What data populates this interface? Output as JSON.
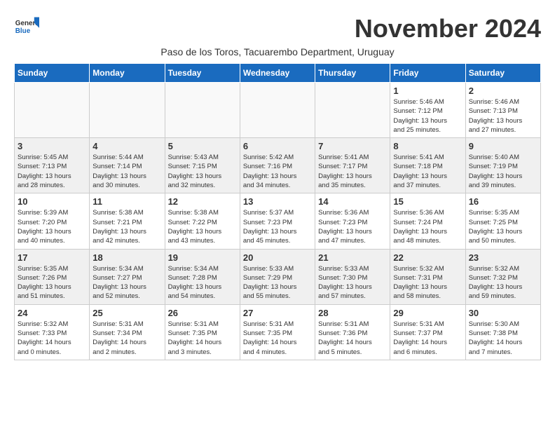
{
  "logo": {
    "line1": "General",
    "line2": "Blue"
  },
  "title": "November 2024",
  "subtitle": "Paso de los Toros, Tacuarembo Department, Uruguay",
  "days_header": [
    "Sunday",
    "Monday",
    "Tuesday",
    "Wednesday",
    "Thursday",
    "Friday",
    "Saturday"
  ],
  "weeks": [
    [
      {
        "day": "",
        "detail": ""
      },
      {
        "day": "",
        "detail": ""
      },
      {
        "day": "",
        "detail": ""
      },
      {
        "day": "",
        "detail": ""
      },
      {
        "day": "",
        "detail": ""
      },
      {
        "day": "1",
        "detail": "Sunrise: 5:46 AM\nSunset: 7:12 PM\nDaylight: 13 hours\nand 25 minutes."
      },
      {
        "day": "2",
        "detail": "Sunrise: 5:46 AM\nSunset: 7:13 PM\nDaylight: 13 hours\nand 27 minutes."
      }
    ],
    [
      {
        "day": "3",
        "detail": "Sunrise: 5:45 AM\nSunset: 7:13 PM\nDaylight: 13 hours\nand 28 minutes."
      },
      {
        "day": "4",
        "detail": "Sunrise: 5:44 AM\nSunset: 7:14 PM\nDaylight: 13 hours\nand 30 minutes."
      },
      {
        "day": "5",
        "detail": "Sunrise: 5:43 AM\nSunset: 7:15 PM\nDaylight: 13 hours\nand 32 minutes."
      },
      {
        "day": "6",
        "detail": "Sunrise: 5:42 AM\nSunset: 7:16 PM\nDaylight: 13 hours\nand 34 minutes."
      },
      {
        "day": "7",
        "detail": "Sunrise: 5:41 AM\nSunset: 7:17 PM\nDaylight: 13 hours\nand 35 minutes."
      },
      {
        "day": "8",
        "detail": "Sunrise: 5:41 AM\nSunset: 7:18 PM\nDaylight: 13 hours\nand 37 minutes."
      },
      {
        "day": "9",
        "detail": "Sunrise: 5:40 AM\nSunset: 7:19 PM\nDaylight: 13 hours\nand 39 minutes."
      }
    ],
    [
      {
        "day": "10",
        "detail": "Sunrise: 5:39 AM\nSunset: 7:20 PM\nDaylight: 13 hours\nand 40 minutes."
      },
      {
        "day": "11",
        "detail": "Sunrise: 5:38 AM\nSunset: 7:21 PM\nDaylight: 13 hours\nand 42 minutes."
      },
      {
        "day": "12",
        "detail": "Sunrise: 5:38 AM\nSunset: 7:22 PM\nDaylight: 13 hours\nand 43 minutes."
      },
      {
        "day": "13",
        "detail": "Sunrise: 5:37 AM\nSunset: 7:23 PM\nDaylight: 13 hours\nand 45 minutes."
      },
      {
        "day": "14",
        "detail": "Sunrise: 5:36 AM\nSunset: 7:23 PM\nDaylight: 13 hours\nand 47 minutes."
      },
      {
        "day": "15",
        "detail": "Sunrise: 5:36 AM\nSunset: 7:24 PM\nDaylight: 13 hours\nand 48 minutes."
      },
      {
        "day": "16",
        "detail": "Sunrise: 5:35 AM\nSunset: 7:25 PM\nDaylight: 13 hours\nand 50 minutes."
      }
    ],
    [
      {
        "day": "17",
        "detail": "Sunrise: 5:35 AM\nSunset: 7:26 PM\nDaylight: 13 hours\nand 51 minutes."
      },
      {
        "day": "18",
        "detail": "Sunrise: 5:34 AM\nSunset: 7:27 PM\nDaylight: 13 hours\nand 52 minutes."
      },
      {
        "day": "19",
        "detail": "Sunrise: 5:34 AM\nSunset: 7:28 PM\nDaylight: 13 hours\nand 54 minutes."
      },
      {
        "day": "20",
        "detail": "Sunrise: 5:33 AM\nSunset: 7:29 PM\nDaylight: 13 hours\nand 55 minutes."
      },
      {
        "day": "21",
        "detail": "Sunrise: 5:33 AM\nSunset: 7:30 PM\nDaylight: 13 hours\nand 57 minutes."
      },
      {
        "day": "22",
        "detail": "Sunrise: 5:32 AM\nSunset: 7:31 PM\nDaylight: 13 hours\nand 58 minutes."
      },
      {
        "day": "23",
        "detail": "Sunrise: 5:32 AM\nSunset: 7:32 PM\nDaylight: 13 hours\nand 59 minutes."
      }
    ],
    [
      {
        "day": "24",
        "detail": "Sunrise: 5:32 AM\nSunset: 7:33 PM\nDaylight: 14 hours\nand 0 minutes."
      },
      {
        "day": "25",
        "detail": "Sunrise: 5:31 AM\nSunset: 7:34 PM\nDaylight: 14 hours\nand 2 minutes."
      },
      {
        "day": "26",
        "detail": "Sunrise: 5:31 AM\nSunset: 7:35 PM\nDaylight: 14 hours\nand 3 minutes."
      },
      {
        "day": "27",
        "detail": "Sunrise: 5:31 AM\nSunset: 7:35 PM\nDaylight: 14 hours\nand 4 minutes."
      },
      {
        "day": "28",
        "detail": "Sunrise: 5:31 AM\nSunset: 7:36 PM\nDaylight: 14 hours\nand 5 minutes."
      },
      {
        "day": "29",
        "detail": "Sunrise: 5:31 AM\nSunset: 7:37 PM\nDaylight: 14 hours\nand 6 minutes."
      },
      {
        "day": "30",
        "detail": "Sunrise: 5:30 AM\nSunset: 7:38 PM\nDaylight: 14 hours\nand 7 minutes."
      }
    ]
  ]
}
